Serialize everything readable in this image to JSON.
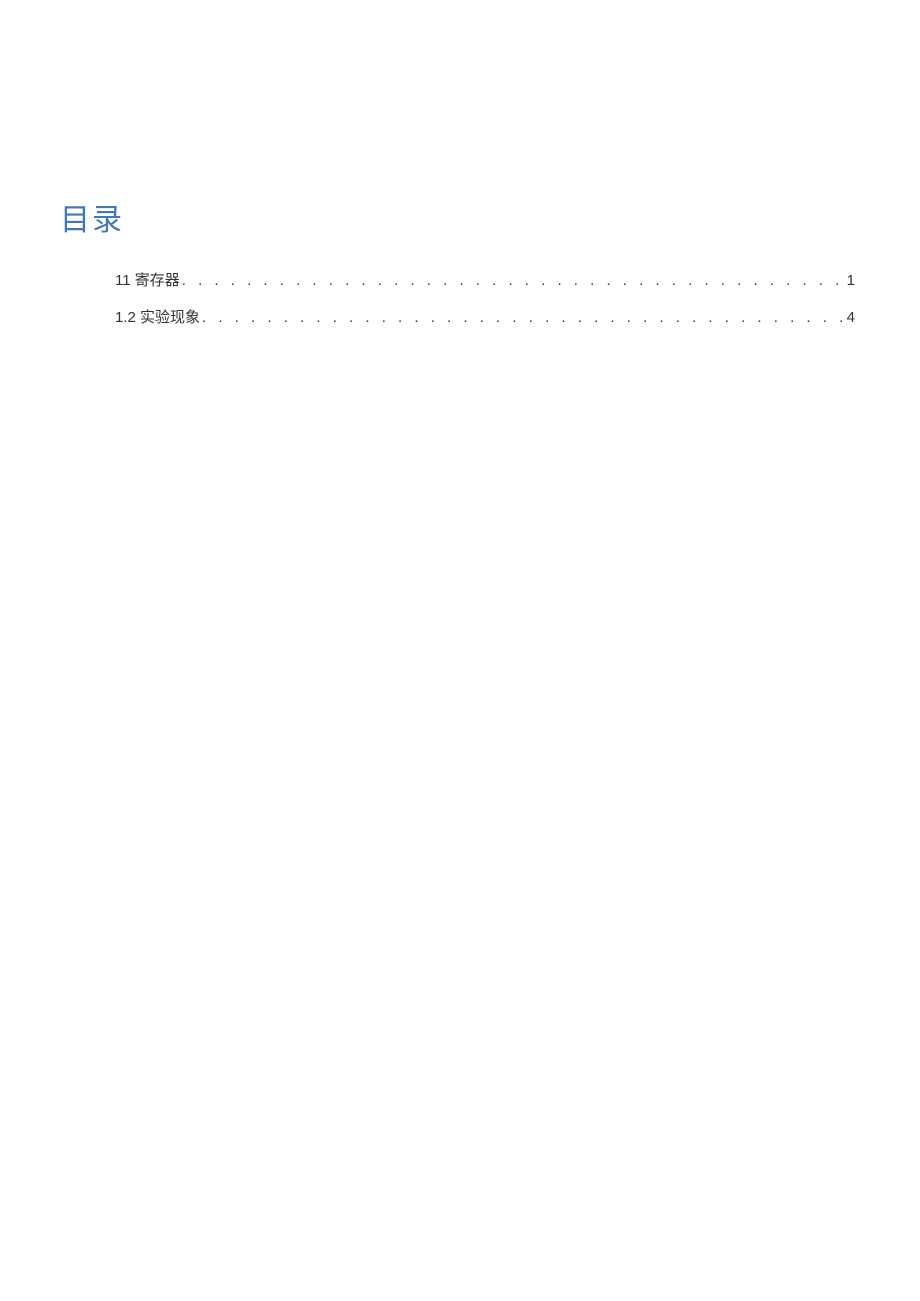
{
  "toc": {
    "title": "目录",
    "entries": [
      {
        "label": "11 寄存器",
        "page": "1"
      },
      {
        "label": "1.2 实验现象",
        "page": "4"
      }
    ]
  }
}
